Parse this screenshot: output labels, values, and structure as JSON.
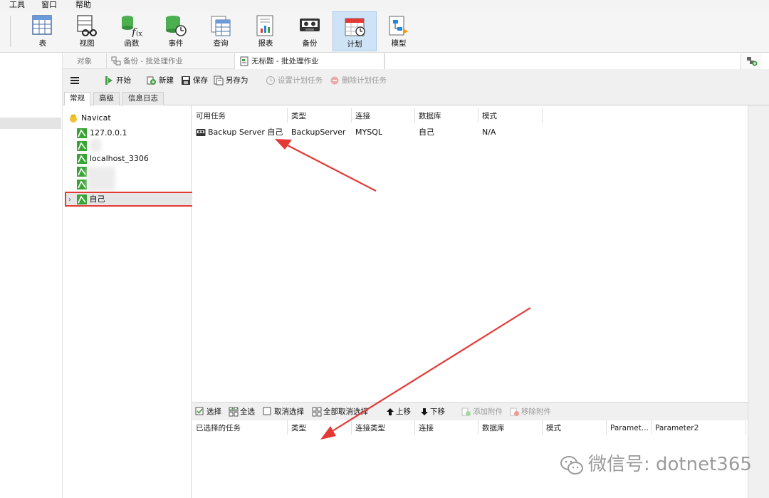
{
  "menu": [
    "工具",
    "窗口",
    "帮助"
  ],
  "ribbon": [
    {
      "label": "表",
      "icon": "table-icon"
    },
    {
      "label": "视图",
      "icon": "view-icon"
    },
    {
      "label": "函数",
      "icon": "function-icon"
    },
    {
      "label": "事件",
      "icon": "event-icon"
    },
    {
      "label": "查询",
      "icon": "query-icon"
    },
    {
      "label": "报表",
      "icon": "report-icon"
    },
    {
      "label": "备份",
      "icon": "backup-icon"
    },
    {
      "label": "计划",
      "icon": "schedule-icon",
      "active": true
    },
    {
      "label": "模型",
      "icon": "model-icon"
    }
  ],
  "tabs": {
    "objects": "对象",
    "backup_tab": "备份 - 批处理作业",
    "untitled_tab": "无标题 - 批处理作业"
  },
  "toolbar": {
    "start": "开始",
    "new": "新建",
    "save": "保存",
    "save_as": "另存为",
    "set_task": "设置计划任务",
    "delete_task": "删除计划任务"
  },
  "subtabs": [
    "常规",
    "高级",
    "信息日志"
  ],
  "tree": {
    "root": "Navicat",
    "items": [
      "127.0.0.1",
      "",
      "localhost_3306",
      "",
      "",
      "自己"
    ]
  },
  "available": {
    "columns": [
      "可用任务",
      "类型",
      "连接",
      "数据库",
      "模式"
    ],
    "rows": [
      {
        "task": "Backup Server 自己",
        "type": "BackupServer",
        "connection": "MYSQL",
        "database": "自己",
        "schema": "N/A"
      }
    ]
  },
  "bottom_toolbar": {
    "select": "选择",
    "select_all": "全选",
    "deselect": "取消选择",
    "deselect_all": "全部取消选择",
    "move_up": "上移",
    "move_down": "下移",
    "add_attachment": "添加附件",
    "remove_attachment": "移除附件"
  },
  "selected": {
    "columns": [
      "已选择的任务",
      "类型",
      "连接类型",
      "连接",
      "数据库",
      "模式",
      "Paramet...",
      "Parameter2"
    ]
  },
  "watermark": "微信号: dotnet365",
  "colors": {
    "accent": "#cfe3f6",
    "highlight": "#e53935",
    "mysql_green": "#3aa335"
  }
}
